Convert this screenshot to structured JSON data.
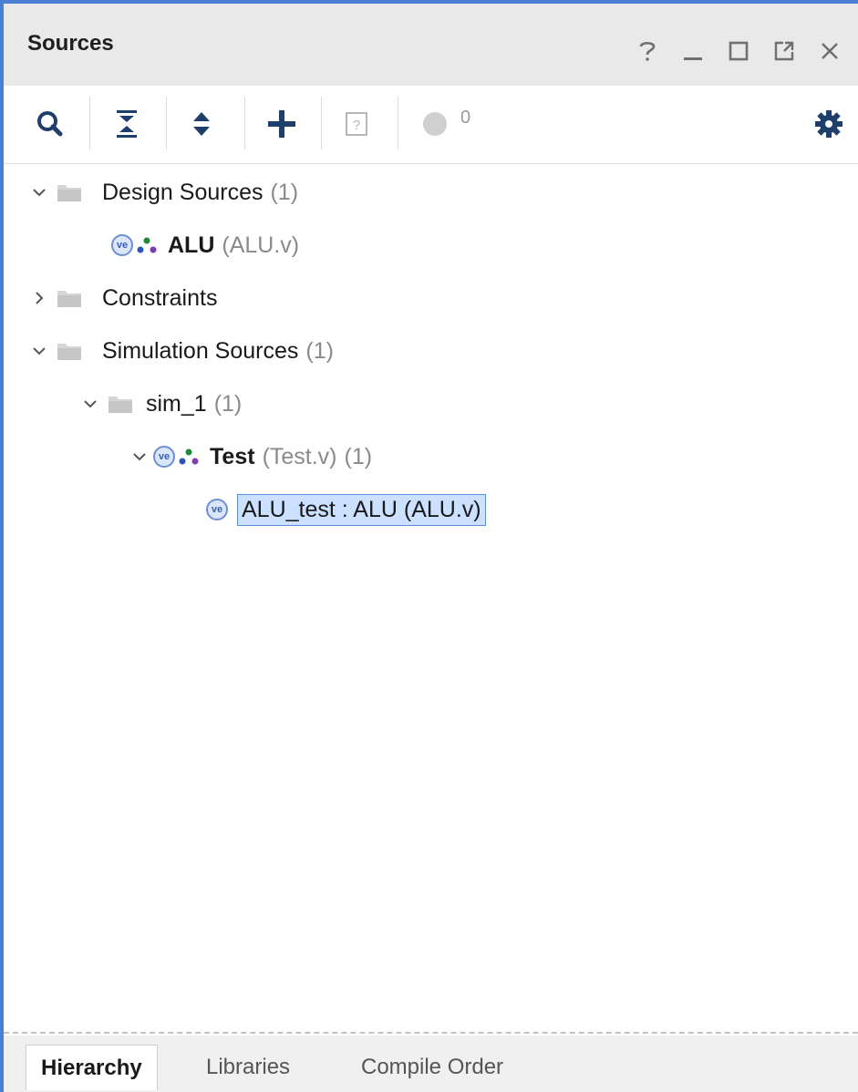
{
  "header": {
    "title": "Sources",
    "window_buttons": [
      {
        "name": "help",
        "glyph": "?"
      },
      {
        "name": "minimize",
        "glyph": "_"
      },
      {
        "name": "maximize",
        "glyph": "□"
      },
      {
        "name": "float",
        "glyph": "↗"
      },
      {
        "name": "close",
        "glyph": "×"
      }
    ]
  },
  "toolbar": {
    "icons": [
      "search-icon",
      "collapse-all-icon",
      "expand-all-icon",
      "add-icon",
      "help-box-icon",
      "status-circle-icon",
      "gear-icon"
    ],
    "status_count": "0"
  },
  "tree": {
    "design_sources": {
      "label": "Design Sources",
      "count": "(1)"
    },
    "alu": {
      "name": "ALU",
      "file": "(ALU.v)"
    },
    "constraints": {
      "label": "Constraints"
    },
    "simulation_sources": {
      "label": "Simulation Sources",
      "count": "(1)"
    },
    "sim_1": {
      "label": "sim_1",
      "count": "(1)"
    },
    "test": {
      "name": "Test",
      "file": "(Test.v)",
      "count": "(1)"
    },
    "alu_test": {
      "label": "ALU_test : ALU (ALU.v)"
    }
  },
  "tabs": [
    {
      "label": "Hierarchy",
      "active": true
    },
    {
      "label": "Libraries",
      "active": false
    },
    {
      "label": "Compile Order",
      "active": false
    }
  ],
  "colors": {
    "accent_border": "#4a7fd4",
    "selection_bg": "#cce0ff",
    "selection_border": "#5b8fe2"
  }
}
